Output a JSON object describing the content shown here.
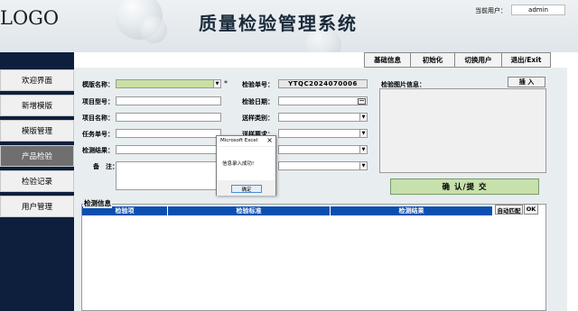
{
  "header": {
    "logo": "LOGO",
    "title": "质量检验管理系统",
    "current_user_label": "当前用户：",
    "current_user_value": "admin"
  },
  "top_menu": [
    {
      "label": "基础信息"
    },
    {
      "label": "初始化"
    },
    {
      "label": "切换用户"
    },
    {
      "label": "退出/Exit"
    }
  ],
  "sidebar": {
    "items": [
      {
        "label": "欢迎界面"
      },
      {
        "label": "新增模版"
      },
      {
        "label": "模版管理"
      },
      {
        "label": "产品检验",
        "active": true
      },
      {
        "label": "检验记录"
      },
      {
        "label": "用户管理"
      }
    ]
  },
  "form": {
    "template_name_label": "模版名称：",
    "template_name_value": "",
    "required_mark": "*",
    "project_no_label": "项目型号：",
    "project_name_label": "项目名称：",
    "task_no_label": "任务单号：",
    "result_label": "检测结果：",
    "remark_label": "备　注：",
    "inspection_no_label": "检验单号：",
    "inspection_no_value": "YTQC2024070006",
    "inspection_date_label": "检验日期：",
    "send_type_label": "送样类别：",
    "send_req_label": "送样要求：",
    "image_label": "检验图片信息：",
    "insert_button": "插 入",
    "confirm_button": "确 认/提 交"
  },
  "results": {
    "section_label": "检测信息",
    "columns": [
      "检验项",
      "检验标准",
      "检测结果"
    ],
    "auto_match_button": "自动匹配",
    "ok_button": "OK"
  },
  "dialog": {
    "title": "Microsoft Excel",
    "close": "×",
    "message": "信息录入成功!",
    "ok_button": "确定"
  },
  "colors": {
    "sidebar_bg": "#0d1f3c",
    "table_header": "#0a4fb0",
    "confirm_green": "#c7e1ac",
    "field_green": "#c9e0a3"
  }
}
